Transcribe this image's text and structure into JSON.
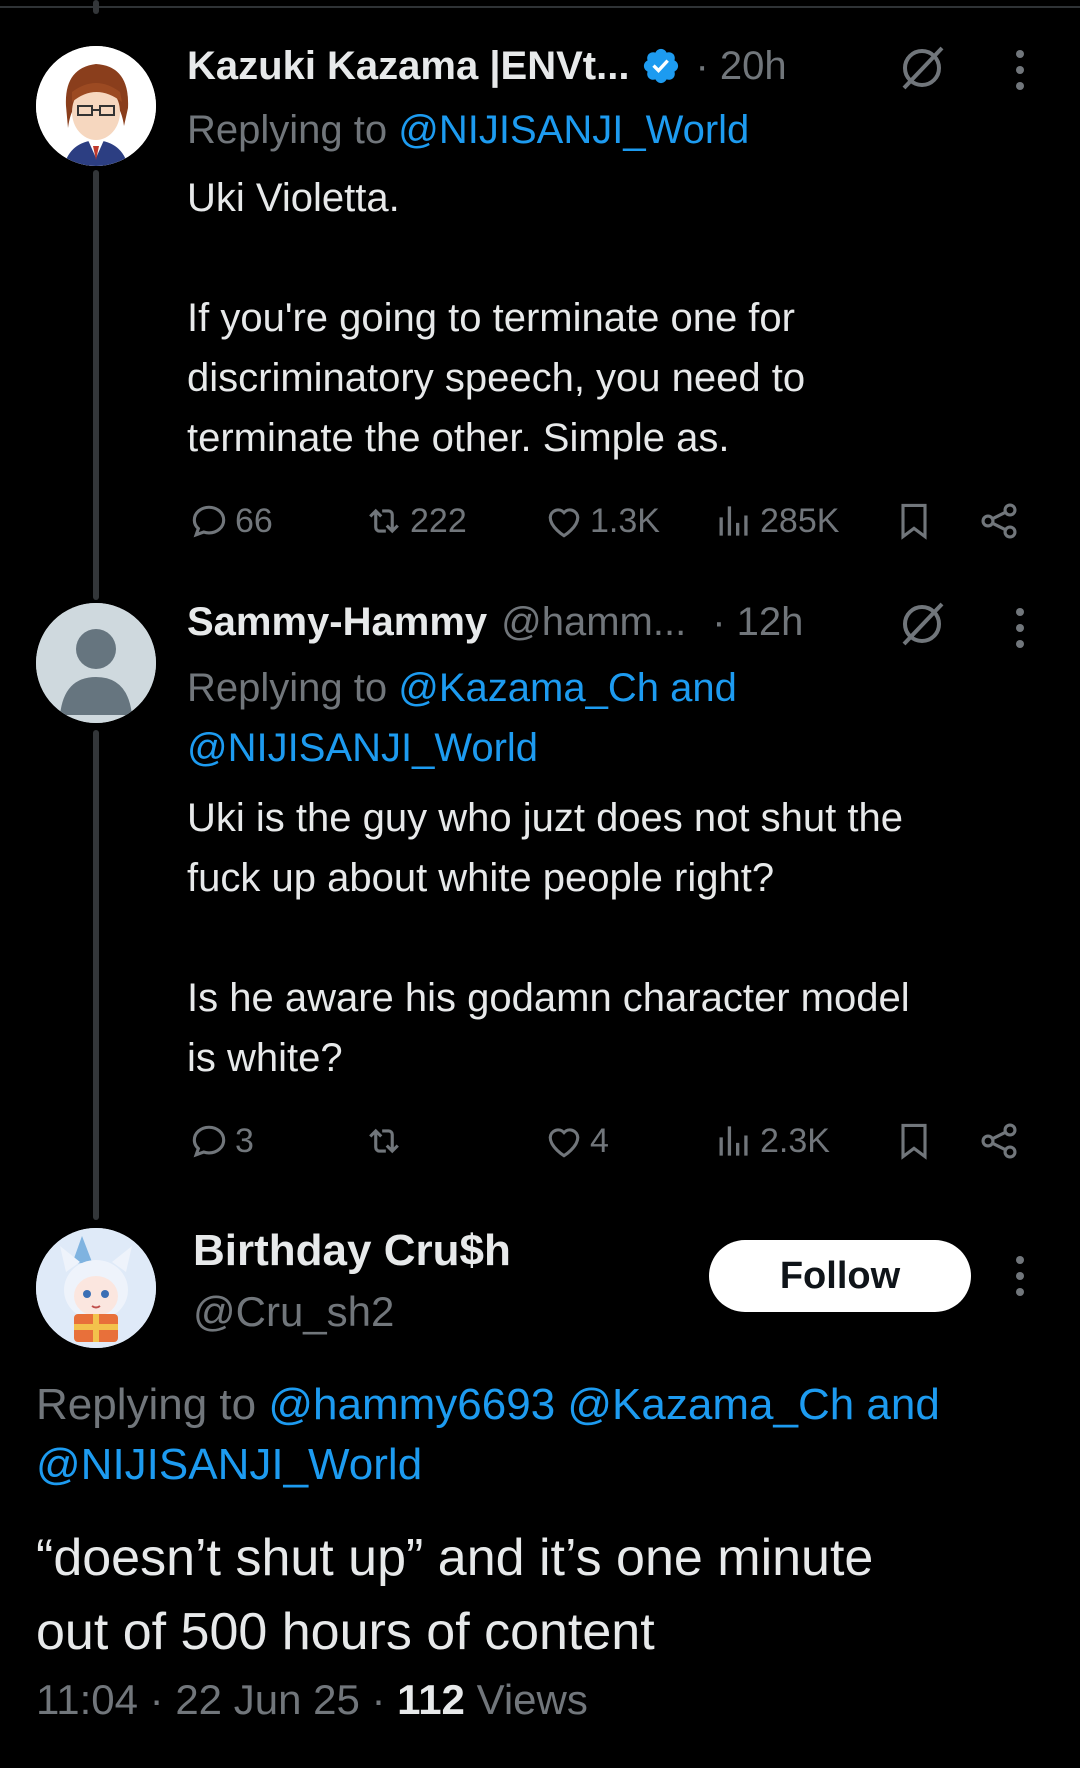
{
  "tweets": [
    {
      "name": "Kazuki Kazama |ENVt...",
      "handle": "",
      "time": "· 20h",
      "verified": true,
      "replying_prefix": "Replying to",
      "replying_to_line1": "@NIJISANJI_World",
      "replying_to_line2": "",
      "text": "Uki Violetta.\n\nIf you're going to terminate one for\ndiscriminatory speech, you need to\nterminate the other. Simple as.",
      "replies": "66",
      "retweets": "222",
      "likes": "1.3K",
      "views": "285K"
    },
    {
      "name": "Sammy-Hammy",
      "handle": "@hamm...",
      "time": "· 12h",
      "verified": false,
      "replying_prefix": "Replying to",
      "replying_to_line1": "@Kazama_Ch and",
      "replying_to_line2": "@NIJISANJI_World",
      "text": "Uki is the guy who juzt does not shut the\nfuck up about white people right?\n\nIs he aware his godamn character model\nis white?",
      "replies": "3",
      "retweets": "",
      "likes": "4",
      "views": "2.3K"
    }
  ],
  "main_tweet": {
    "name": "Birthday Cru$h",
    "handle": "@Cru_sh2",
    "follow_label": "Follow",
    "replying_prefix": "Replying to",
    "replying_to_line1": "@hammy6693 @Kazama_Ch and",
    "replying_to_line2": "@NIJISANJI_World",
    "text": "“doesn’t shut up” and it’s one minute\nout of 500 hours of content",
    "time": "11:04",
    "date": "22 Jun 25",
    "views_count": "112",
    "views_label": "Views"
  },
  "colors": {
    "background": "#000000",
    "text": "#e7e9ea",
    "muted": "#71767b",
    "link": "#1d9bf0",
    "verified": "#1d9bf0"
  },
  "icons": [
    "reply-icon",
    "retweet-icon",
    "like-icon",
    "views-icon",
    "bookmark-icon",
    "share-icon",
    "grok-icon",
    "more-icon",
    "verified-badge-icon"
  ]
}
